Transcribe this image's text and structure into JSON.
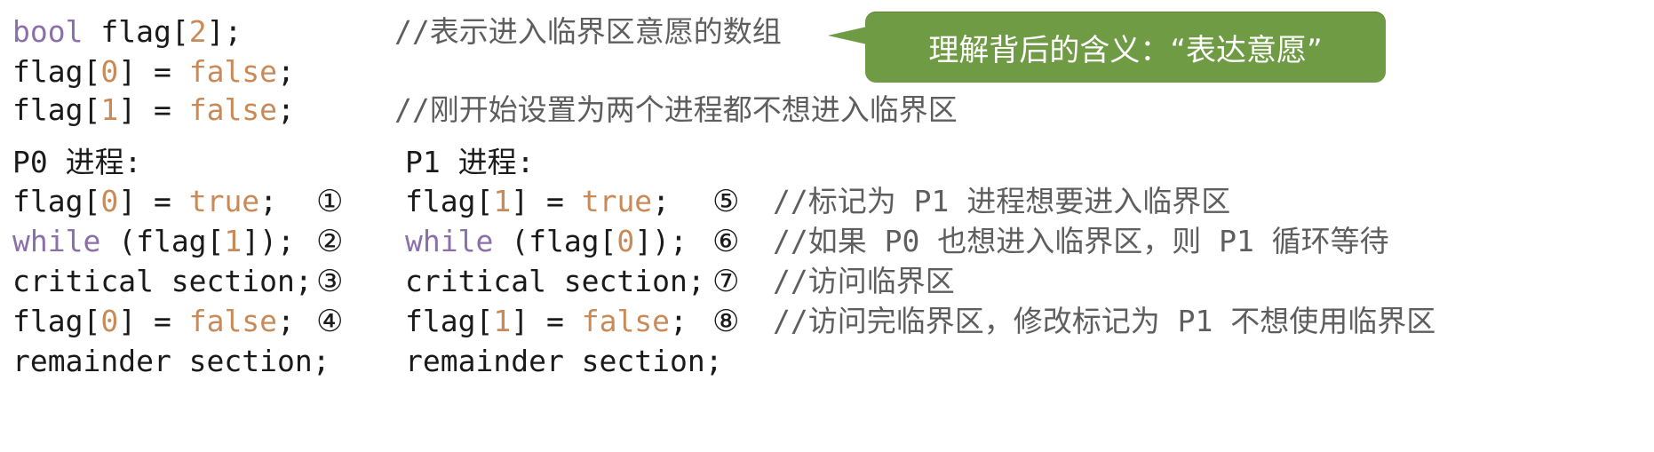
{
  "header": {
    "l1_kw": "bool",
    "l1_rest": " flag[",
    "l1_num": "2",
    "l1_end": "];",
    "l1_comment": "//表示进入临界区意愿的数组",
    "l2_pre": "flag[",
    "l2_num": "0",
    "l2_mid": "] = ",
    "l2_bool": "false",
    "l2_end": ";",
    "l3_pre": "flag[",
    "l3_num": "1",
    "l3_mid": "] = ",
    "l3_bool": "false",
    "l3_end": ";",
    "l3_comment": "//刚开始设置为两个进程都不想进入临界区"
  },
  "callout": {
    "text": "理解背后的含义：“表达意愿”"
  },
  "p0": {
    "title": "P0 进程:",
    "l1_pre": "flag[",
    "l1_num": "0",
    "l1_mid": "] = ",
    "l1_bool": "true",
    "l1_end": ";",
    "l2_kw": "while",
    "l2_pre": " (flag[",
    "l2_num": "1",
    "l2_end": "]);",
    "l3": "critical section;",
    "l4_pre": "flag[",
    "l4_num": "0",
    "l4_mid": "] = ",
    "l4_bool": "false",
    "l4_end": ";",
    "l5": "remainder section;"
  },
  "p1": {
    "title": "P1 进程:",
    "l1_pre": "flag[",
    "l1_num": "1",
    "l1_mid": "] = ",
    "l1_bool": "true",
    "l1_end": ";",
    "l2_kw": "while",
    "l2_pre": " (flag[",
    "l2_num": "0",
    "l2_end": "]);",
    "l3": "critical section;",
    "l4_pre": "flag[",
    "l4_num": "1",
    "l4_mid": "] = ",
    "l4_bool": "false",
    "l4_end": ";",
    "l5": "remainder section;"
  },
  "markers": {
    "m1": "①",
    "m2": "②",
    "m3": "③",
    "m4": "④",
    "m5": "⑤",
    "m6": "⑥",
    "m7": "⑦",
    "m8": "⑧"
  },
  "comments": {
    "c5": "//标记为 P1 进程想要进入临界区",
    "c6": "//如果 P0 也想进入临界区，则 P1 循环等待",
    "c7": "//访问临界区",
    "c8": "//访问完临界区，修改标记为 P1 不想使用临界区"
  },
  "colors": {
    "keyword": "#8b6fa8",
    "literal": "#c98a58",
    "comment": "#5e5e5e",
    "callout_bg": "#6f9b45"
  }
}
